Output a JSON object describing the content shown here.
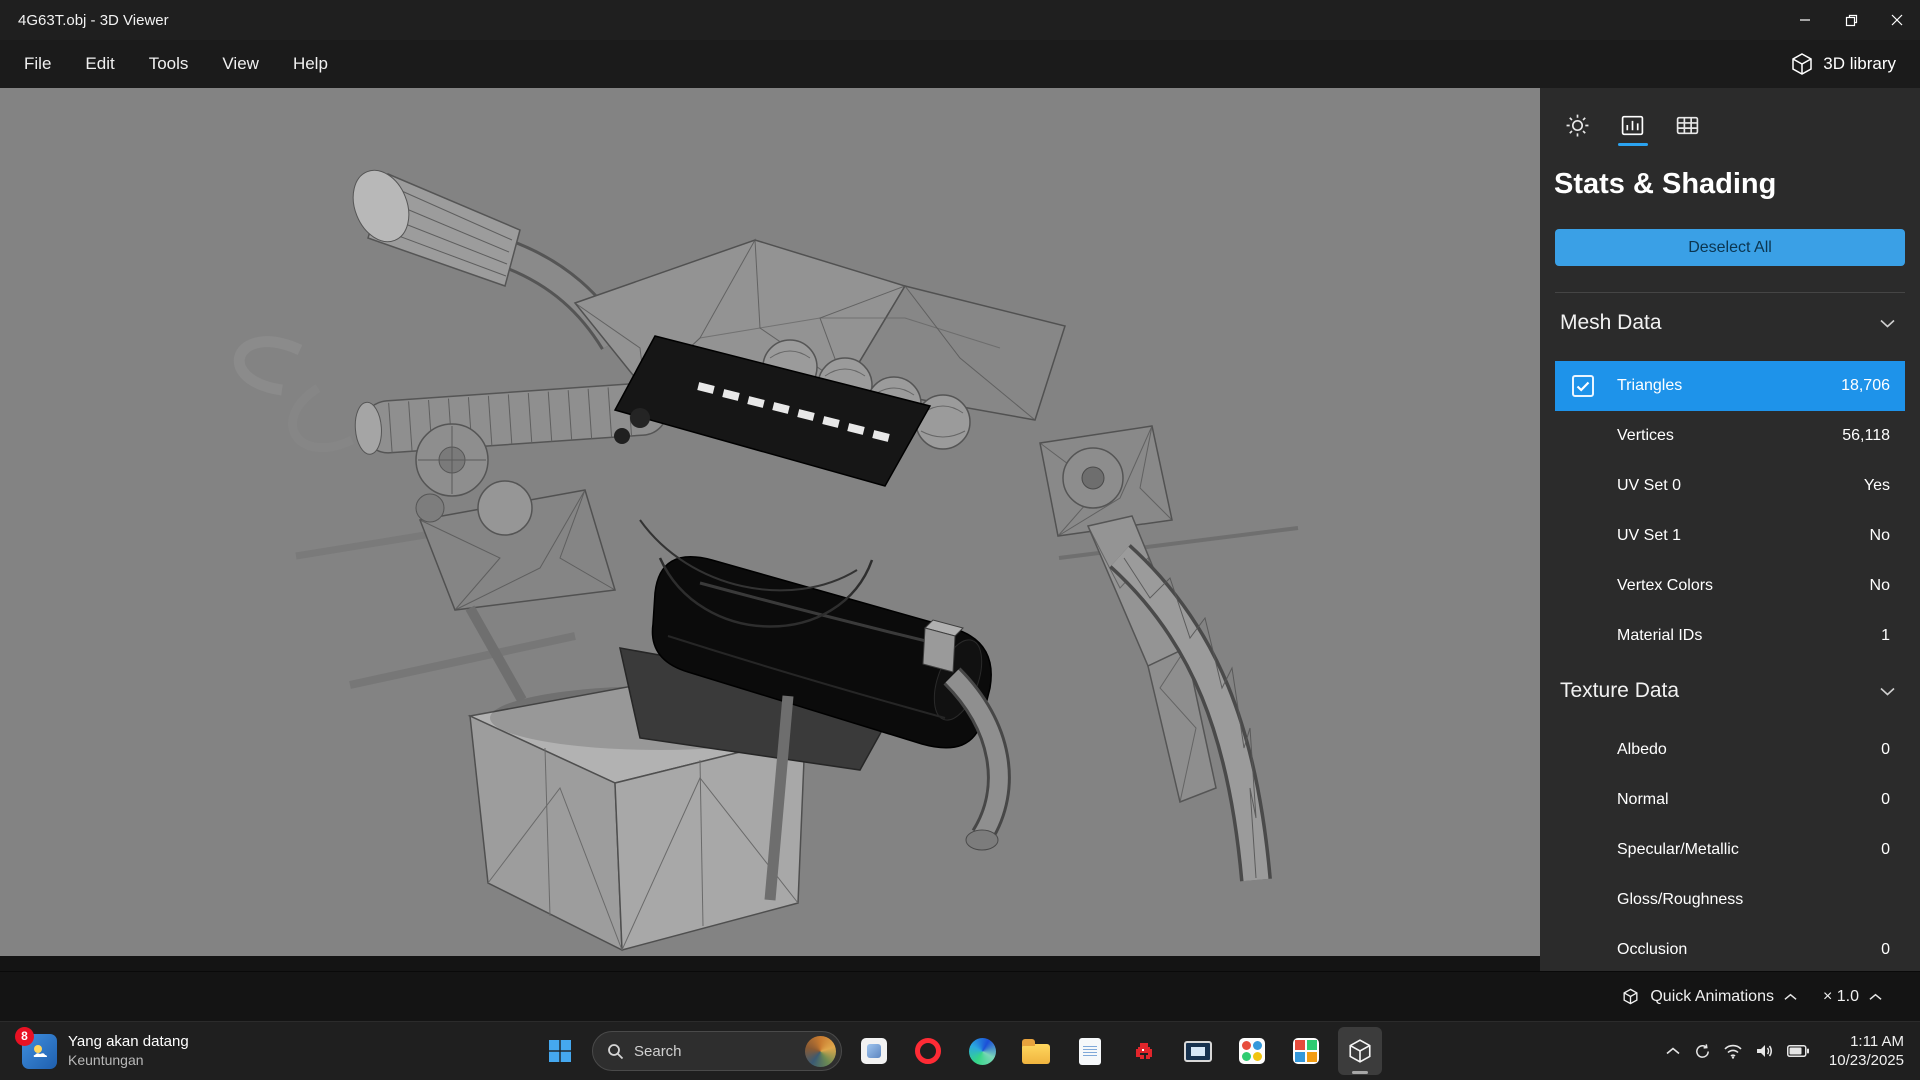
{
  "titlebar": {
    "title": "4G63T.obj - 3D Viewer"
  },
  "menubar": {
    "items": [
      "File",
      "Edit",
      "Tools",
      "View",
      "Help"
    ],
    "library_label": "3D library"
  },
  "panel": {
    "title": "Stats & Shading",
    "deselect_label": "Deselect All",
    "mesh": {
      "header": "Mesh Data",
      "rows": [
        {
          "label": "Triangles",
          "value": "18,706",
          "selected": true
        },
        {
          "label": "Vertices",
          "value": "56,118"
        },
        {
          "label": "UV Set 0",
          "value": "Yes"
        },
        {
          "label": "UV Set 1",
          "value": "No"
        },
        {
          "label": "Vertex Colors",
          "value": "No"
        },
        {
          "label": "Material IDs",
          "value": "1"
        }
      ]
    },
    "texture": {
      "header": "Texture Data",
      "rows": [
        {
          "label": "Albedo",
          "value": "0"
        },
        {
          "label": "Normal",
          "value": "0"
        },
        {
          "label": "Specular/Metallic",
          "value": "0"
        },
        {
          "label": "Gloss/Roughness",
          "value": ""
        },
        {
          "label": "Occlusion",
          "value": "0"
        }
      ]
    },
    "bottom_bar": {
      "animations_label": "Quick Animations",
      "speed_label": "× 1.0"
    }
  },
  "taskbar": {
    "widget": {
      "badge": "8",
      "line1": "Yang akan datang",
      "line2": "Keuntungan"
    },
    "search_label": "Search",
    "clock": {
      "time": "1:11 AM",
      "date": "10/23/2025"
    }
  },
  "colors": {
    "accent_row": "#1e93ea",
    "accent_button": "#3aa0e6",
    "tab_underline": "#2ba3f0",
    "viewport_bg": "#838383"
  }
}
